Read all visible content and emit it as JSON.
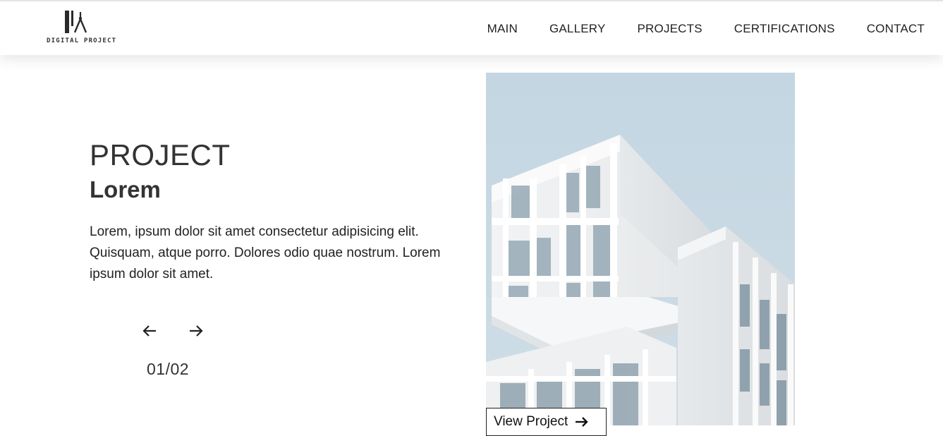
{
  "brand": {
    "logo_text": "DIGITAL PROJECT"
  },
  "nav": {
    "items": [
      "MAIN",
      "GALLERY",
      "PROJECTS",
      "CERTIFICATIONS",
      "CONTACT"
    ]
  },
  "hero": {
    "kicker": "PROJECT",
    "title": "Lorem",
    "description": "Lorem, ipsum dolor sit amet consectetur adipisicing elit. Quisquam, atque porro. Dolores odio quae nostrum. Lorem ipsum dolor sit amet.",
    "counter": "01/02",
    "prev_icon": "arrow-left-icon",
    "next_icon": "arrow-right-icon"
  },
  "feature": {
    "cta_label": "View Project",
    "cta_icon": "arrow-right-icon"
  },
  "colors": {
    "sky": "#c6d8e3",
    "building": "#eef0f1",
    "text": "#222222"
  }
}
